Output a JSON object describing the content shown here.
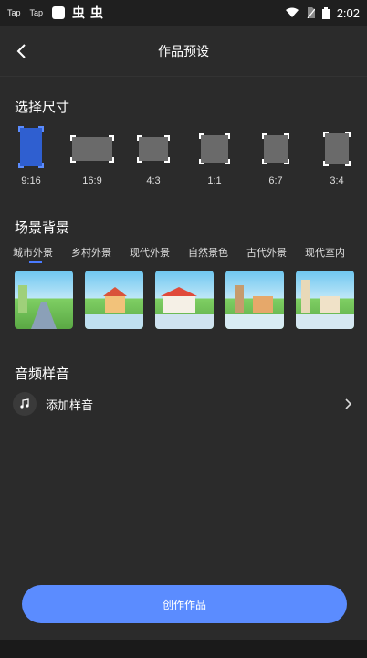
{
  "status_bar": {
    "app1": "Tap",
    "app2": "Tap",
    "char1": "虫",
    "char2": "虫",
    "time": "2:02"
  },
  "header": {
    "title": "作品预设",
    "back_icon": "chevron-left-icon"
  },
  "size_section": {
    "title": "选择尺寸",
    "selected": "9:16",
    "options": [
      "9:16",
      "16:9",
      "4:3",
      "1:1",
      "6:7",
      "3:4"
    ]
  },
  "scene_section": {
    "title": "场景背景",
    "tabs": [
      "城市外景",
      "乡村外景",
      "现代外景",
      "自然景色",
      "古代外景",
      "现代室内"
    ],
    "active_tab": "城市外景",
    "thumbnails": [
      "city-street",
      "country-field",
      "modern-town",
      "nature-village",
      "ancient-town",
      "modern-indoor"
    ]
  },
  "audio_section": {
    "title": "音频样音",
    "add_label": "添加样音",
    "note_icon": "music-note-icon",
    "chevron_icon": "chevron-right-icon"
  },
  "footer": {
    "create_label": "创作作品"
  },
  "colors": {
    "background": "#2b2b2b",
    "accent": "#5b8cff",
    "selected_frame": "#2f5fd0"
  }
}
